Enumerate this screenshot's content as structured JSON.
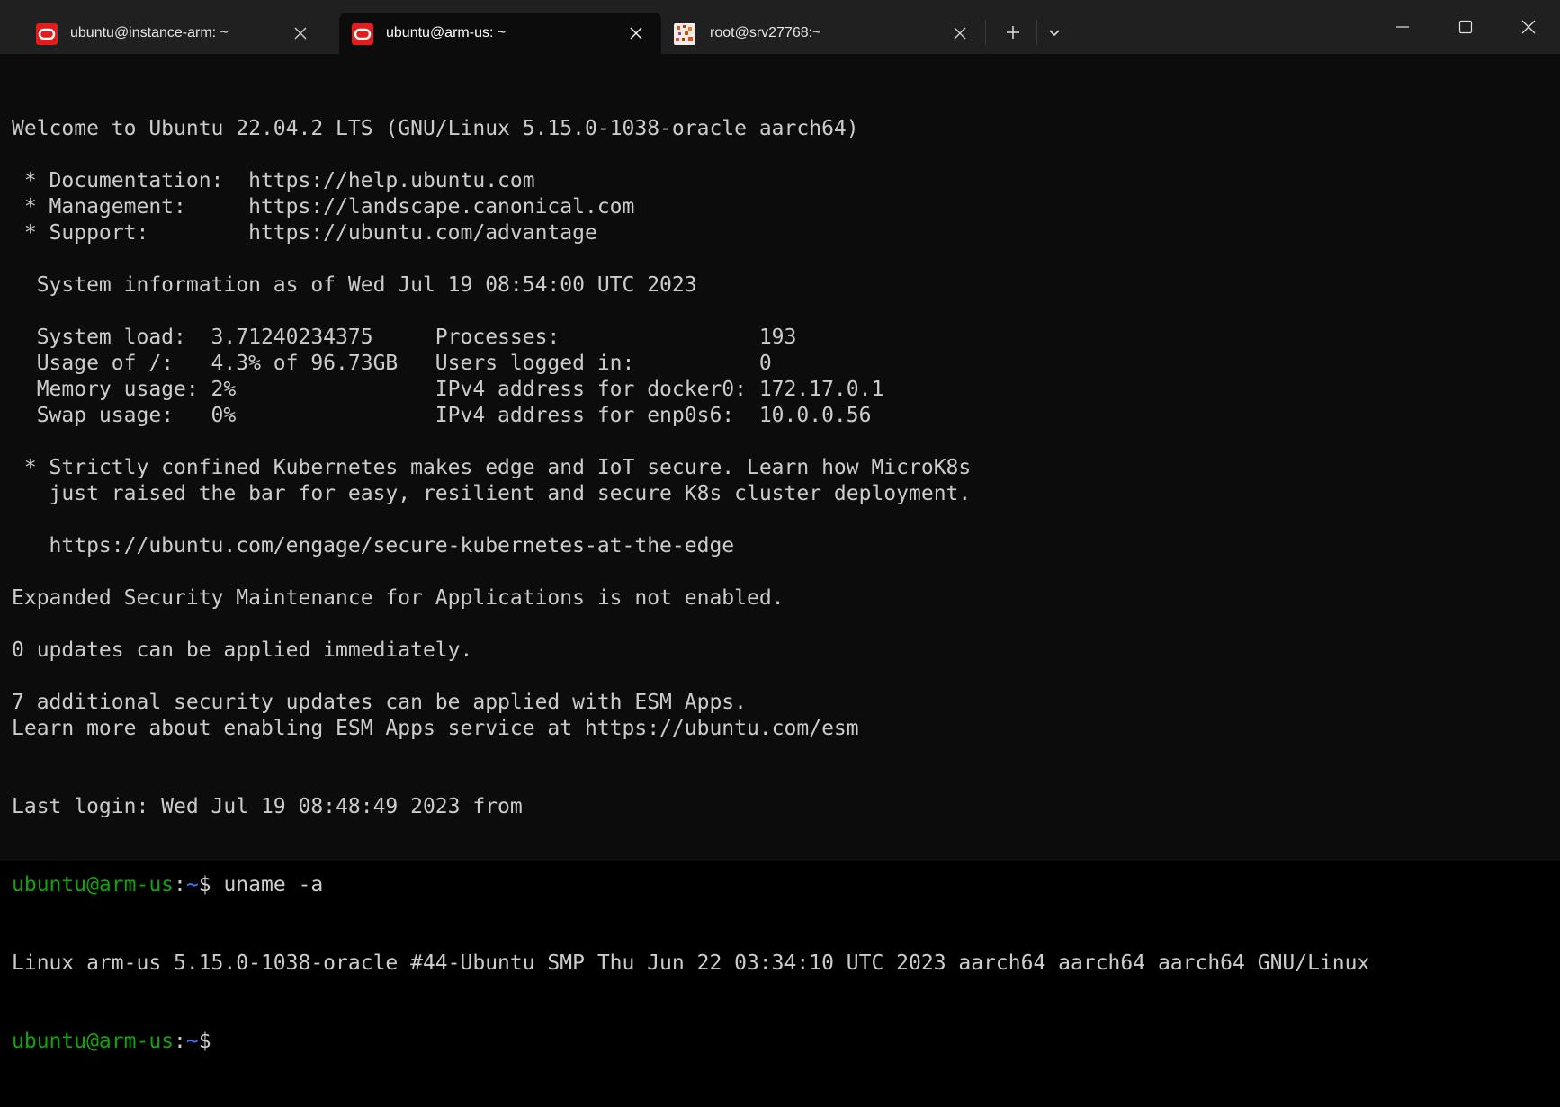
{
  "tabs": [
    {
      "title": "ubuntu@instance-arm: ~",
      "icon": "oracle-icon",
      "active": false
    },
    {
      "title": "ubuntu@arm-us: ~",
      "icon": "oracle-icon",
      "active": true
    },
    {
      "title": "root@srv27768:~",
      "icon": "server-icon",
      "active": false
    }
  ],
  "toolbar": {
    "new_tab": "+",
    "dropdown_icon": "chevron-down-icon"
  },
  "window_controls": {
    "minimize_icon": "minimize-icon",
    "maximize_icon": "maximize-icon",
    "close_icon": "close-icon"
  },
  "colors": {
    "prompt_user": "#13a10e",
    "prompt_path": "#3b78ff",
    "text": "#cccccc",
    "background": "#0c0c0c",
    "oracle_red": "#e01e1e"
  },
  "terminal": {
    "lines": [
      "Welcome to Ubuntu 22.04.2 LTS (GNU/Linux 5.15.0-1038-oracle aarch64)",
      "",
      " * Documentation:  https://help.ubuntu.com",
      " * Management:     https://landscape.canonical.com",
      " * Support:        https://ubuntu.com/advantage",
      "",
      "  System information as of Wed Jul 19 08:54:00 UTC 2023",
      "",
      "  System load:  3.71240234375     Processes:                193",
      "  Usage of /:   4.3% of 96.73GB   Users logged in:          0",
      "  Memory usage: 2%                IPv4 address for docker0: 172.17.0.1",
      "  Swap usage:   0%                IPv4 address for enp0s6:  10.0.0.56",
      "",
      " * Strictly confined Kubernetes makes edge and IoT secure. Learn how MicroK8s",
      "   just raised the bar for easy, resilient and secure K8s cluster deployment.",
      "",
      "   https://ubuntu.com/engage/secure-kubernetes-at-the-edge",
      "",
      "Expanded Security Maintenance for Applications is not enabled.",
      "",
      "0 updates can be applied immediately.",
      "",
      "7 additional security updates can be applied with ESM Apps.",
      "Learn more about enabling ESM Apps service at https://ubuntu.com/esm",
      "",
      "",
      "Last login: Wed Jul 19 08:48:49 2023 from"
    ],
    "prompt1": {
      "user_host": "ubuntu@arm-us",
      "colon": ":",
      "path": "~",
      "symbol": "$ ",
      "command": "uname -a"
    },
    "output": "Linux arm-us 5.15.0-1038-oracle #44-Ubuntu SMP Thu Jun 22 03:34:10 UTC 2023 aarch64 aarch64 aarch64 GNU/Linux",
    "prompt2": {
      "user_host": "ubuntu@arm-us",
      "colon": ":",
      "path": "~",
      "symbol": "$"
    }
  }
}
